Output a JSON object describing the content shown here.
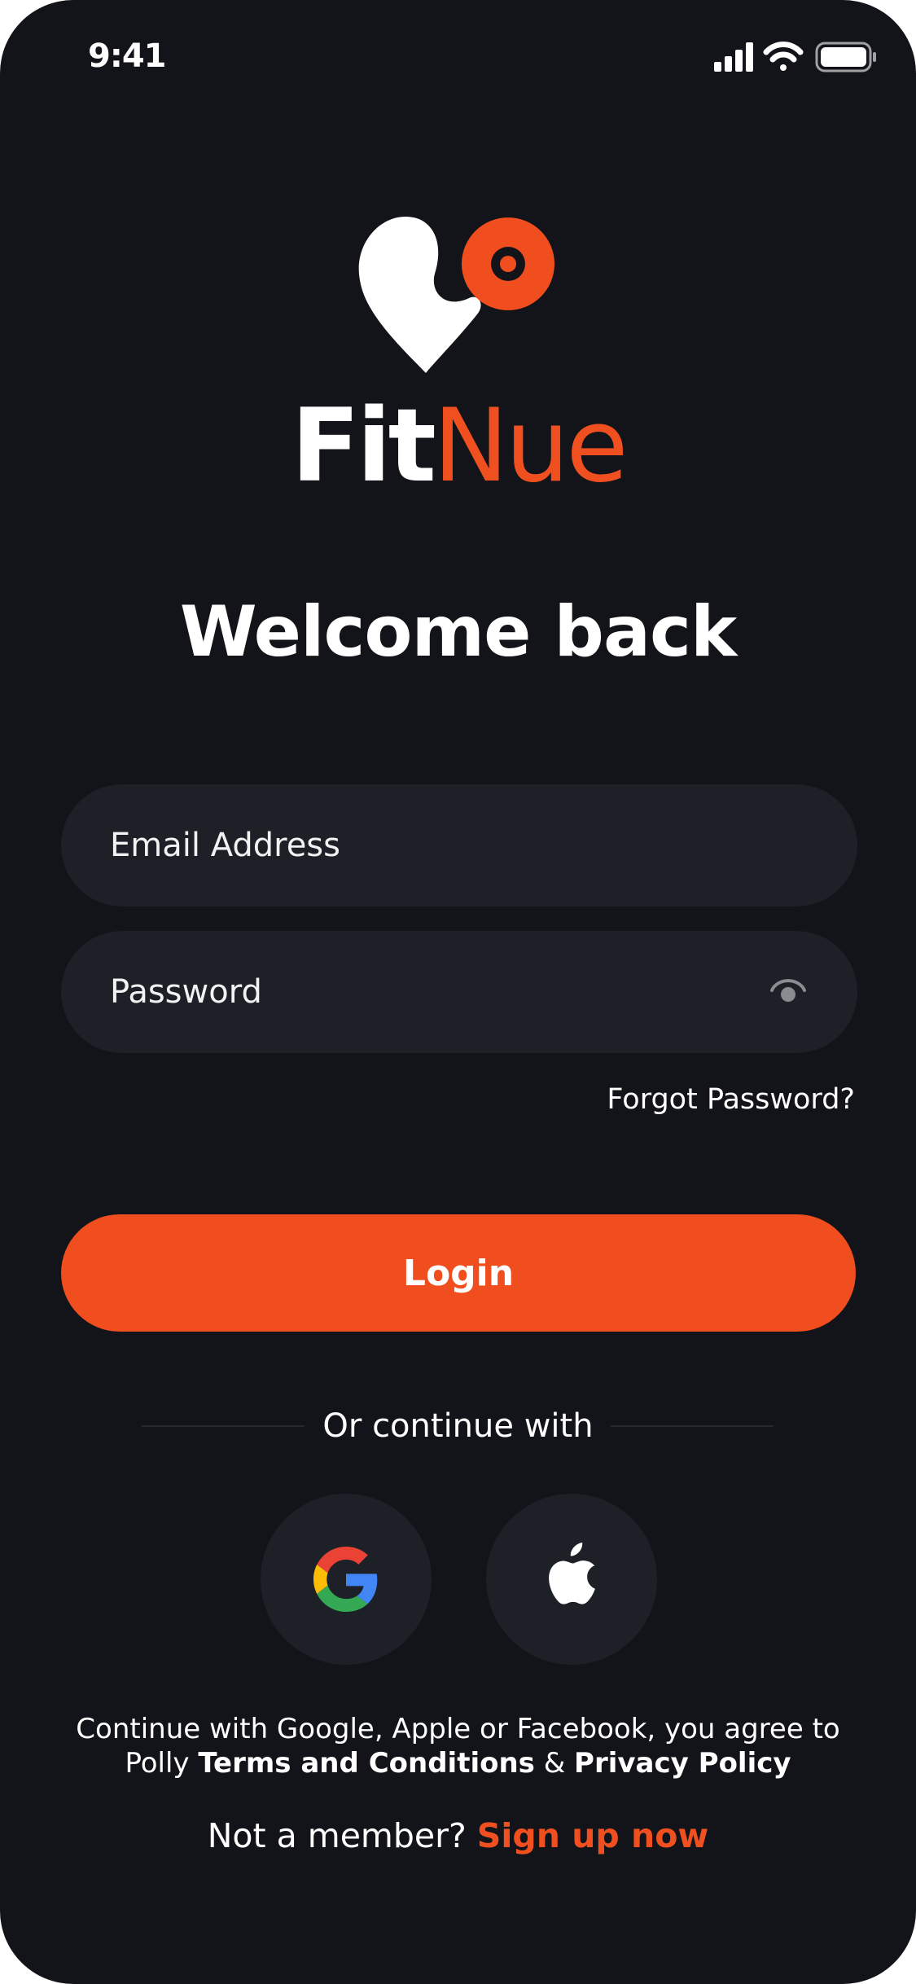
{
  "status_bar": {
    "time": "9:41",
    "icons": [
      "cellular-signal-icon",
      "wifi-icon",
      "battery-icon"
    ]
  },
  "brand": {
    "logo_icon": "heart-target-logo-icon",
    "name_part1": "Fit",
    "name_part2": "Nue",
    "accent_color": "#F04E1E"
  },
  "welcome": {
    "title": "Welcome back"
  },
  "form": {
    "email_placeholder": "Email Address",
    "email_value": "",
    "password_placeholder": "Password",
    "password_value": "",
    "password_toggle_icon": "eye-icon",
    "forgot_password": "Forgot Password?",
    "login_label": "Login"
  },
  "social": {
    "divider_text": "Or continue with",
    "buttons": [
      {
        "name": "google",
        "icon": "google-icon"
      },
      {
        "name": "apple",
        "icon": "apple-icon"
      }
    ]
  },
  "terms": {
    "line1": "Continue with Google, Apple or Facebook, you agree to",
    "prefix": "Polly",
    "terms_link": "Terms and Conditions",
    "ampersand": "&",
    "privacy_link": "Privacy Policy"
  },
  "signup": {
    "prompt": "Not a member?",
    "link": "Sign up now"
  }
}
